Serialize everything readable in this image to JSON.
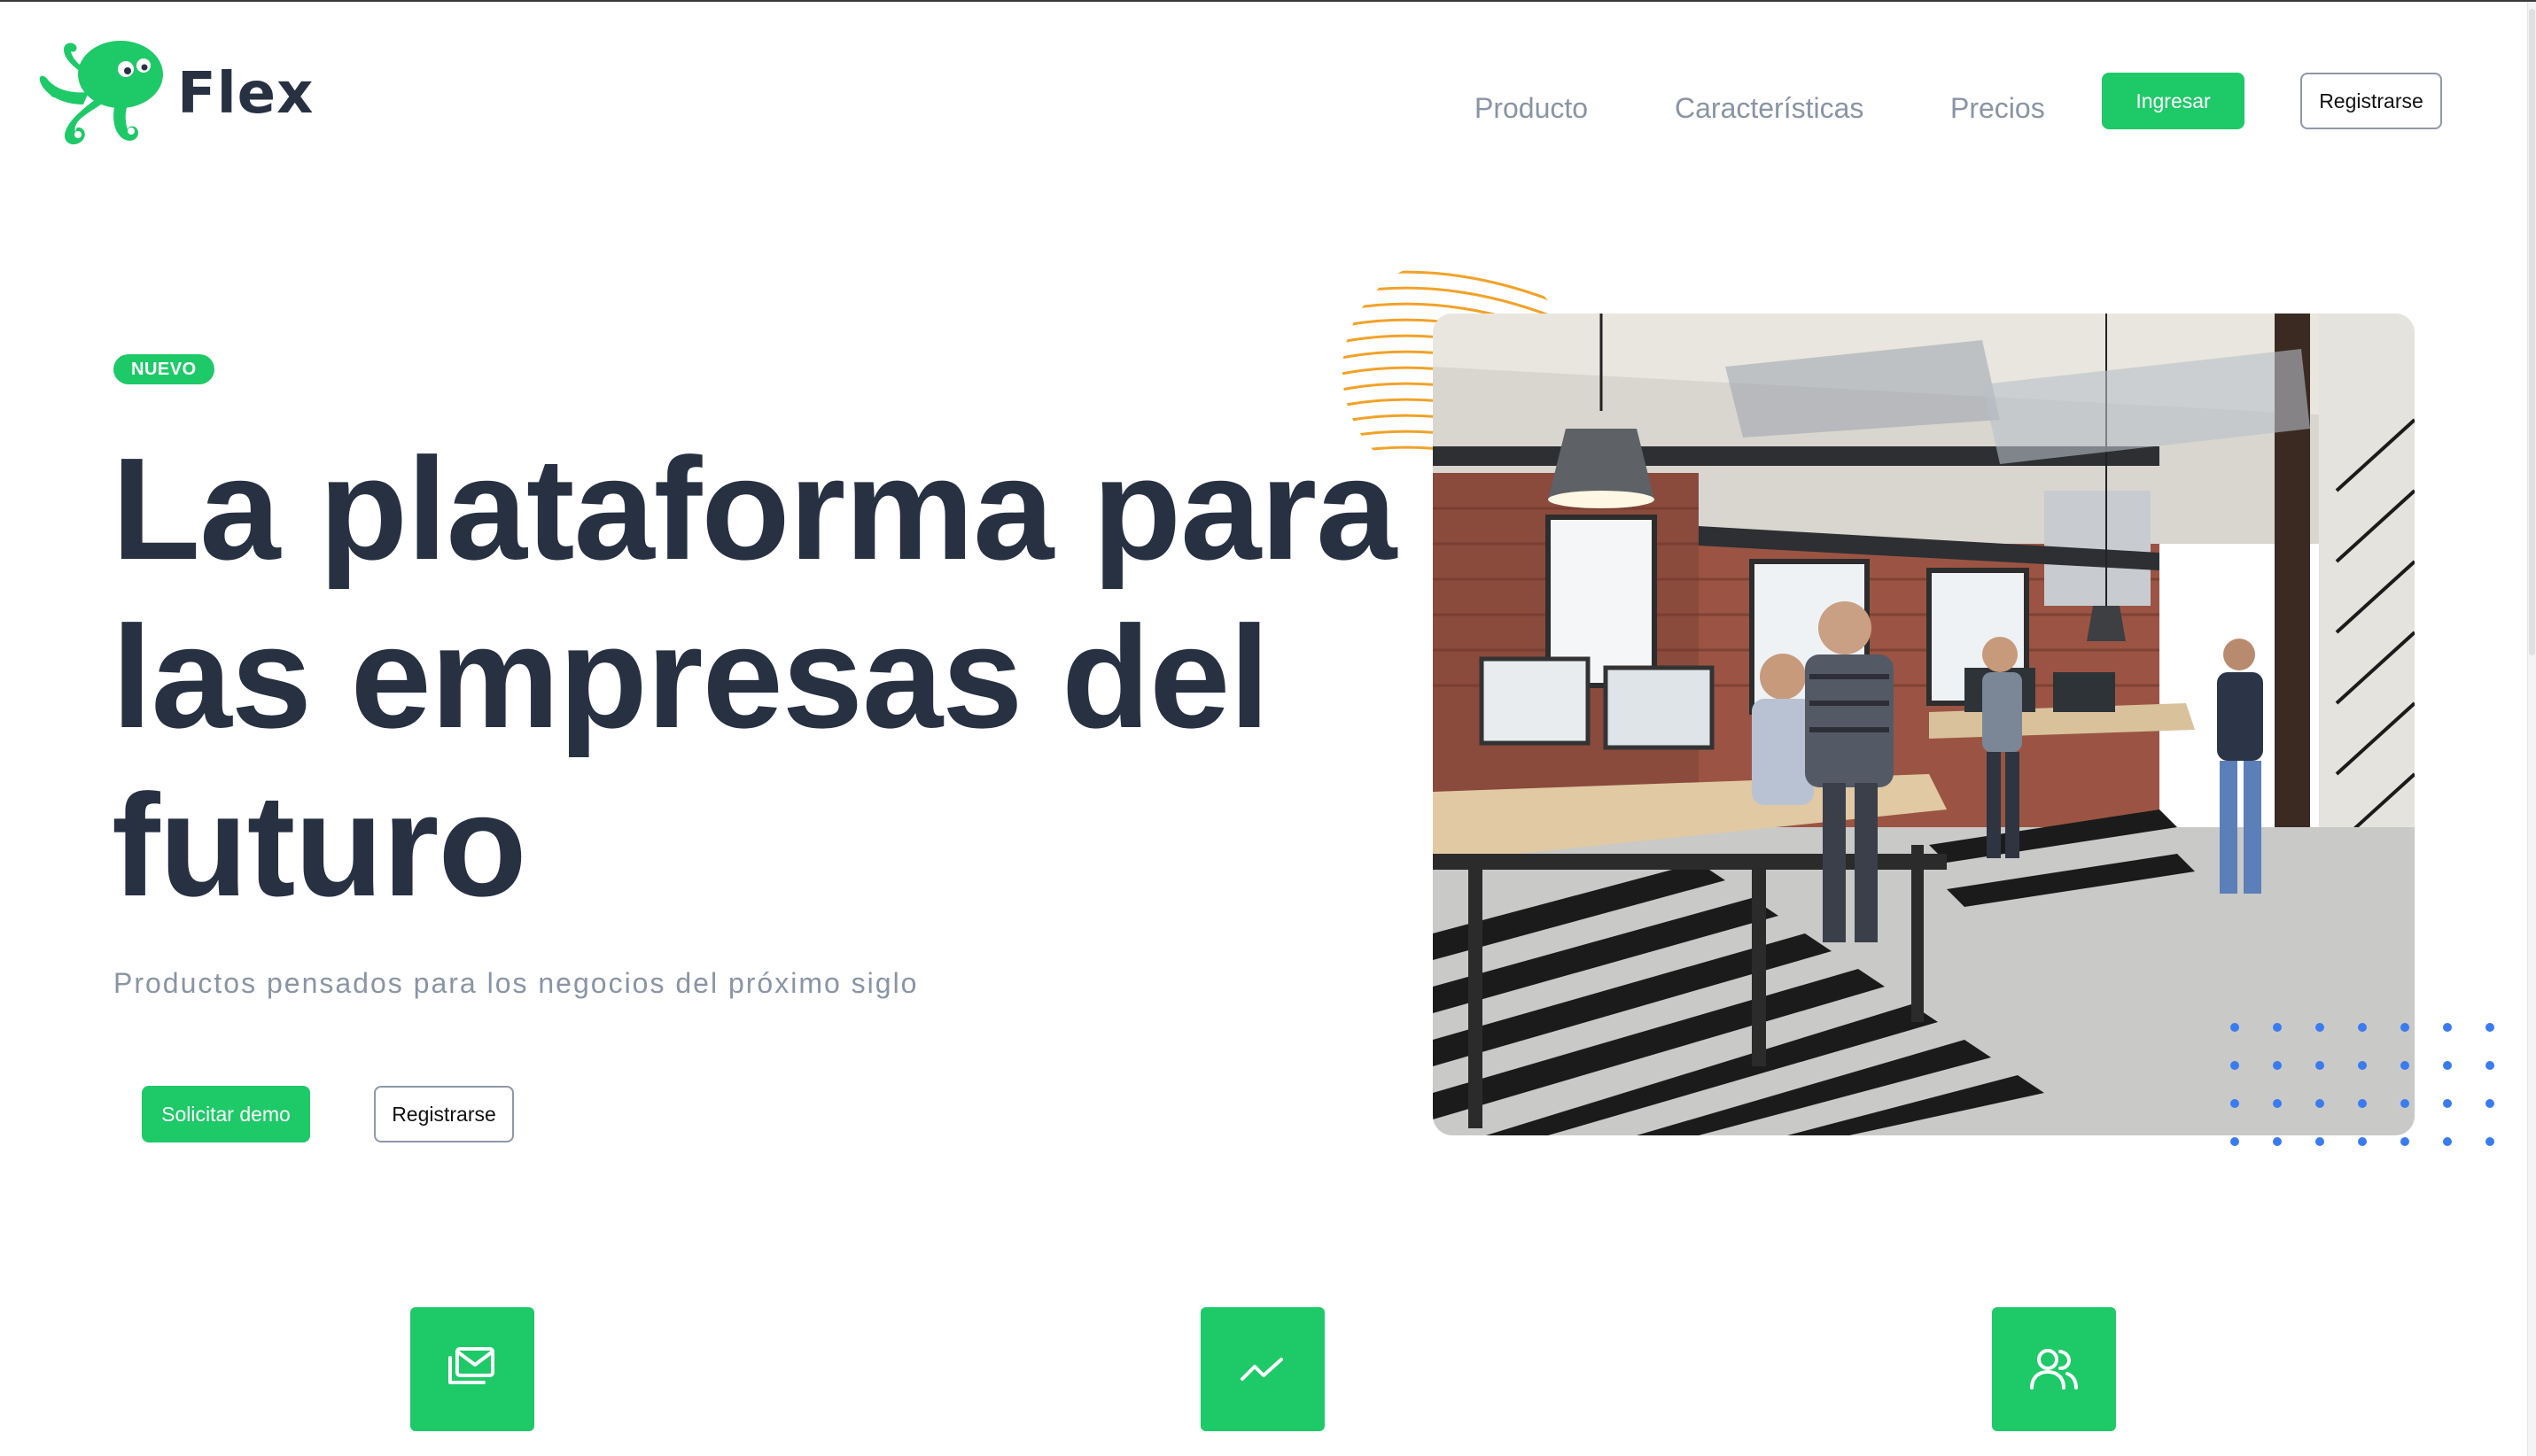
{
  "brand": {
    "name": "Flex",
    "logo_icon": "octopus-icon",
    "accent_color": "#1ec968",
    "text_color": "#273142",
    "muted_color": "#8994a5"
  },
  "nav": {
    "items": [
      {
        "label": "Producto"
      },
      {
        "label": "Características"
      },
      {
        "label": "Precios"
      }
    ],
    "login_label": "Ingresar",
    "signup_label": "Registrarse"
  },
  "hero": {
    "badge": "NUEVO",
    "title_line_1": "La plataforma para",
    "title_line_2": "las empresas del",
    "title_line_3": "futuro",
    "subtitle": "Productos pensados para los negocios del próximo siglo",
    "demo_label": "Solicitar demo",
    "signup_label": "Registrarse",
    "image_description_icon": "office-photo",
    "rings_color": "#f2a227",
    "dots_color": "#3b7bf0"
  },
  "features": [
    {
      "icon": "mail-stack-icon"
    },
    {
      "icon": "trend-chart-icon"
    },
    {
      "icon": "users-icon"
    }
  ]
}
